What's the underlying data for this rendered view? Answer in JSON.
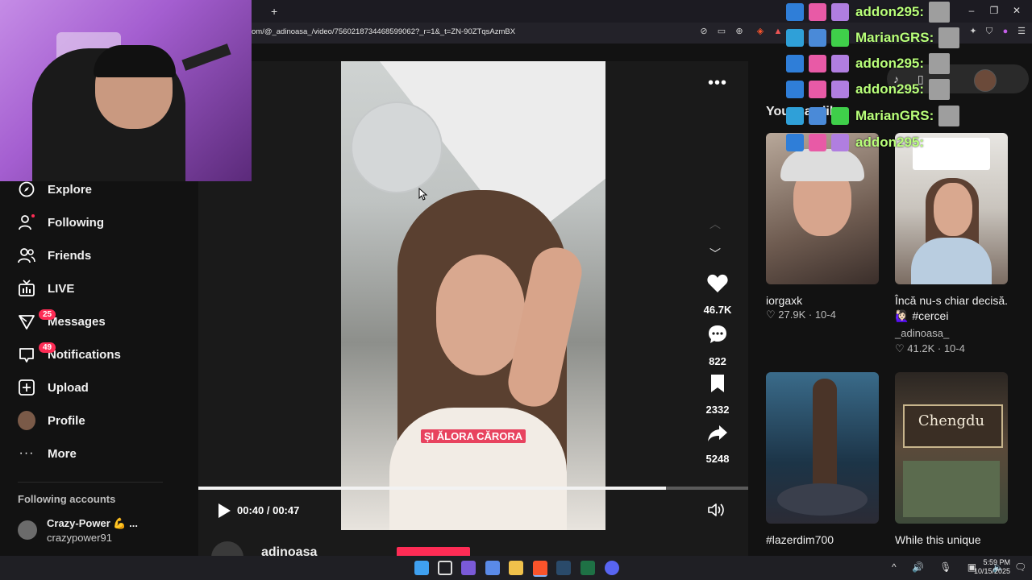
{
  "browser": {
    "new_tab_symbol": "+",
    "url": "om/@_adinoasa_/video/7560218734468599062?_r=1&_t=ZN-90ZTqsAzmBX"
  },
  "sidebar": {
    "items": [
      {
        "label": "Explore",
        "icon": "compass-icon"
      },
      {
        "label": "Following",
        "icon": "following-icon"
      },
      {
        "label": "Friends",
        "icon": "friends-icon"
      },
      {
        "label": "LIVE",
        "icon": "live-icon"
      },
      {
        "label": "Messages",
        "icon": "messages-icon",
        "badge": "25"
      },
      {
        "label": "Notifications",
        "icon": "notifications-icon",
        "badge": "49"
      },
      {
        "label": "Upload",
        "icon": "upload-icon"
      },
      {
        "label": "Profile",
        "icon": "profile-avatar"
      },
      {
        "label": "More",
        "icon": "more-icon"
      }
    ],
    "following_accounts_heading": "Following accounts",
    "accounts": [
      {
        "name": "Crazy-Power 💪 ...",
        "username": "crazypower91"
      }
    ]
  },
  "video": {
    "caption_text": "ȘI ĂLORA CĂRORA",
    "time": "00:40 / 00:47",
    "progress": 0.85,
    "author": "adinoasa",
    "actions": {
      "likes": "46.7K",
      "comments": "822",
      "saves": "2332",
      "shares": "5248"
    }
  },
  "recommendations": {
    "heading": "You may like",
    "items": [
      {
        "caption": "iorgaxk",
        "likes": "27.9K",
        "date": "10-4",
        "author": ""
      },
      {
        "caption": "Încă nu-s chiar decisă. 🙋🏻‍♀️ #cercei",
        "likes": "41.2K",
        "date": "10-4",
        "author": "_adinoasa_"
      },
      {
        "caption": "#lazerdim700",
        "likes": "",
        "date": "",
        "author": ""
      },
      {
        "caption": "While this unique",
        "likes": "",
        "date": "",
        "author": ""
      }
    ],
    "thumb4_sign": "Chengdu"
  },
  "chat": [
    {
      "user": "addon295:"
    },
    {
      "user": "MarianGRS:"
    },
    {
      "user": "addon295:"
    },
    {
      "user": "addon295:"
    },
    {
      "user": "MarianGRS:"
    },
    {
      "user": "addon295:"
    }
  ],
  "taskbar": {
    "time": "5:59 PM",
    "date": "10/15/2025"
  },
  "colors": {
    "accent": "#fe2c55",
    "chat_name": "#b9ff7a",
    "background": "#121212"
  }
}
